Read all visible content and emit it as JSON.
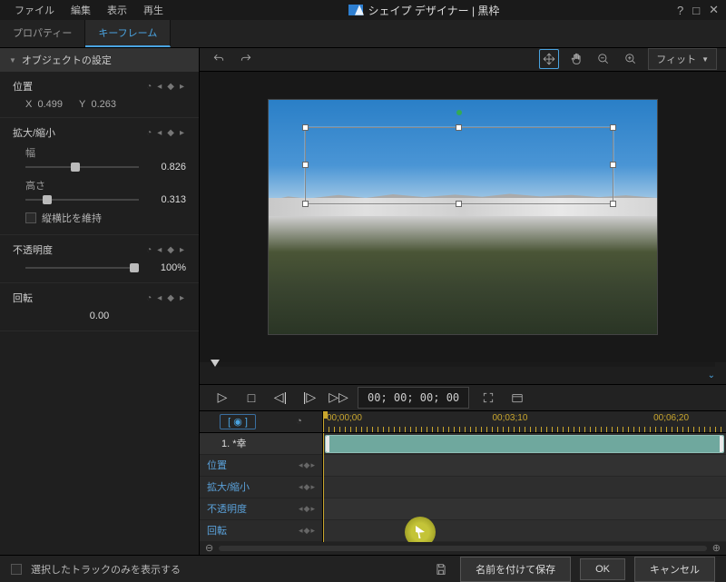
{
  "window": {
    "title": "シェイプ デザイナー  |  黒枠"
  },
  "menu": {
    "file": "ファイル",
    "edit": "編集",
    "view": "表示",
    "play": "再生"
  },
  "tabs": {
    "properties": "プロパティー",
    "keyframe": "キーフレーム"
  },
  "groups": {
    "object_settings": "オブジェクトの設定"
  },
  "props": {
    "position": {
      "label": "位置",
      "x_label": "X",
      "x": "0.499",
      "y_label": "Y",
      "y": "0.263"
    },
    "scale": {
      "label": "拡大/縮小",
      "width_label": "幅",
      "width": "0.826",
      "height_label": "高さ",
      "height": "0.313",
      "keep_ratio": "縦横比を維持"
    },
    "opacity": {
      "label": "不透明度",
      "value": "100%"
    },
    "rotation": {
      "label": "回転",
      "value": "0.00"
    }
  },
  "toolbar": {
    "fit": "フィット"
  },
  "transport": {
    "timecode": "00; 00; 00; 00"
  },
  "timeline": {
    "ticks": [
      "00;00;00",
      "00;03;10",
      "00;06;20"
    ],
    "track_name": "1.  *幸",
    "tracks": [
      "位置",
      "拡大/縮小",
      "不透明度",
      "回転"
    ]
  },
  "footer": {
    "show_selected": "選択したトラックのみを表示する",
    "save_as": "名前を付けて保存",
    "ok": "OK",
    "cancel": "キャンセル"
  }
}
